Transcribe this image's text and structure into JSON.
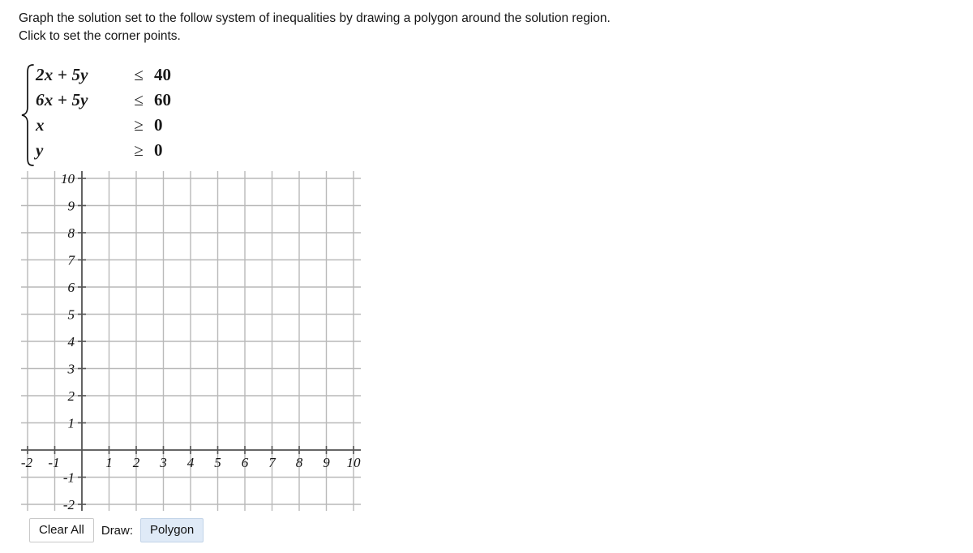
{
  "prompt": {
    "line1": "Graph the solution set to the follow system of inequalities by drawing a polygon around the solution region.",
    "line2": "Click to set the corner points."
  },
  "system": {
    "rows": [
      {
        "lhs_coef1": "2",
        "lhs_var1": "x",
        "lhs_plus": "+",
        "lhs_coef2": "5",
        "lhs_var2": "y",
        "lhs": "2x + 5y",
        "relation": "≤",
        "rhs": "40"
      },
      {
        "lhs_coef1": "6",
        "lhs_var1": "x",
        "lhs_plus": "+",
        "lhs_coef2": "5",
        "lhs_var2": "y",
        "lhs": "6x + 5y",
        "relation": "≤",
        "rhs": "60"
      },
      {
        "lhs": "x",
        "relation": "≥",
        "rhs": "0"
      },
      {
        "lhs": "y",
        "relation": "≥",
        "rhs": "0"
      }
    ]
  },
  "chart_data": {
    "type": "scatter",
    "title": "",
    "xlabel": "",
    "ylabel": "",
    "xlim": [
      -2,
      10
    ],
    "ylim": [
      -2,
      10
    ],
    "xticks": [
      -2,
      -1,
      1,
      2,
      3,
      4,
      5,
      6,
      7,
      8,
      9,
      10
    ],
    "yticks": [
      -2,
      -1,
      1,
      2,
      3,
      4,
      5,
      6,
      7,
      8,
      9,
      10
    ],
    "xtick_labels": [
      "-2",
      "-1",
      "1",
      "2",
      "3",
      "4",
      "5",
      "6",
      "7",
      "8",
      "9",
      "10"
    ],
    "ytick_labels": [
      "-2",
      "-1",
      "1",
      "2",
      "3",
      "4",
      "5",
      "6",
      "7",
      "8",
      "9",
      "10"
    ],
    "grid": true,
    "grid_step": 1,
    "legend": "none",
    "series": [],
    "annotations": [],
    "axis_color": "#555555",
    "grid_color": "#b9b9b9"
  },
  "toolbar": {
    "clear_all_label": "Clear All",
    "draw_label": "Draw:",
    "polygon_label": "Polygon",
    "accent_color": "#dfeaf7"
  }
}
